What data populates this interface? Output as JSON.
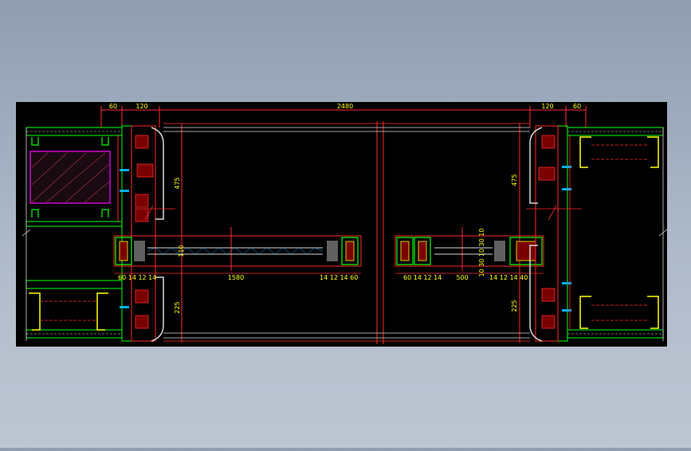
{
  "app": {
    "title": ""
  },
  "colors": {
    "background": "#000000",
    "dimension": "#ff2a2a",
    "text": "#ffff00",
    "frame": "#00ff00",
    "steel": "#ffff00",
    "glass": "#d9d9d9",
    "seal": "#00b0ff",
    "accent": "#ff00ff"
  },
  "drawing": {
    "top_dims": {
      "left_60": "60",
      "left_120": "120",
      "overall": "2480",
      "right_120": "120",
      "right_60": "60"
    },
    "vertical_dims": {
      "upper_left": "475",
      "lower_left": "225",
      "upper_right": "475",
      "lower_right": "225",
      "center_left": "110"
    },
    "bottom_dims": {
      "left_chain": "60 14 12 14",
      "left_span": "1580",
      "left_end_chain": "14 12 14 60",
      "right_chain": "60 14 12 14",
      "right_span": "500",
      "right_end_chain": "14 12 14 40",
      "right_vertical_chain": "10 30 10 30 10"
    }
  }
}
